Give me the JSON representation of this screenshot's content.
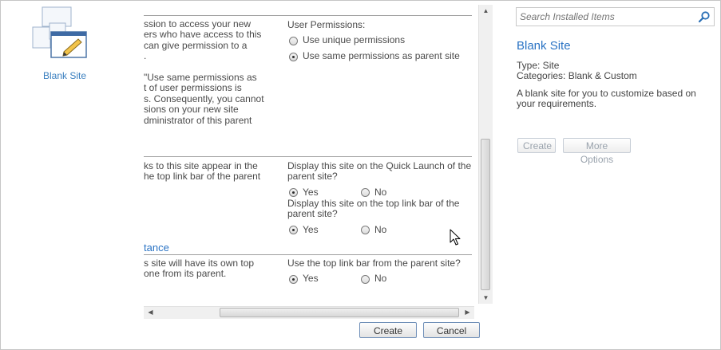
{
  "template": {
    "name": "Blank Site"
  },
  "form": {
    "permissions": {
      "description": "ssion to access your new\ners who have access to this\ncan give permission to a\n.\n\n\"Use same permissions as\nt of user permissions is\ns. Consequently, you cannot\nsions on your new site\ndministrator of this parent",
      "question": "User Permissions:",
      "options": [
        {
          "label": "Use unique permissions",
          "selected": false
        },
        {
          "label": "Use same permissions as parent site",
          "selected": true
        }
      ]
    },
    "navigation": {
      "description": "ks to this site appear in the\nhe top link bar of the parent",
      "quick_launch_question": "Display this site on the Quick Launch of the parent site?",
      "top_link_question": "Display this site on the top link bar of the parent site?",
      "yes": "Yes",
      "no": "No",
      "quick_launch_value": "Yes",
      "top_link_value": "Yes"
    },
    "inheritance": {
      "heading": "tance",
      "description": "s site will have its own top\none from its parent.",
      "question": "Use the top link bar from the parent site?",
      "yes": "Yes",
      "no": "No",
      "value": "Yes"
    }
  },
  "buttons": {
    "create": "Create",
    "cancel": "Cancel"
  },
  "details": {
    "search_placeholder": "Search Installed Items",
    "title": "Blank Site",
    "type": "Type: Site",
    "categories": "Categories: Blank & Custom",
    "description": "A blank site for you to customize based on your requirements.",
    "create": "Create",
    "more_options": "More Options"
  },
  "colors": {
    "link": "#2a73c4",
    "accent_border": "#6f8fb8"
  },
  "icons": {
    "template": "site-template-icon",
    "search": "magnifier-icon",
    "cursor": "mouse-pointer-icon"
  }
}
